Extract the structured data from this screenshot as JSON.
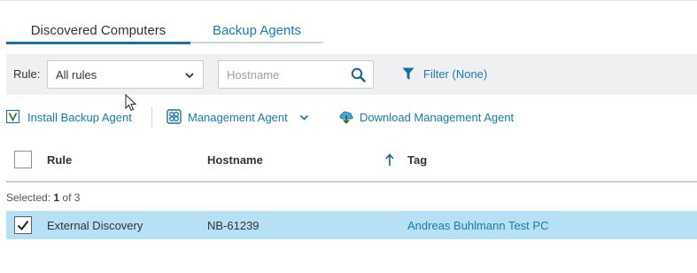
{
  "tabs": [
    {
      "label": "Discovered Computers",
      "active": true
    },
    {
      "label": "Backup Agents",
      "active": false
    }
  ],
  "filter": {
    "rule_label": "Rule:",
    "rule_value": "All rules",
    "hostname_placeholder": "Hostname",
    "filter_label": "Filter (None)"
  },
  "actions": {
    "install": "Install Backup Agent",
    "management": "Management Agent",
    "download": "Download Management Agent"
  },
  "columns": {
    "rule": "Rule",
    "hostname": "Hostname",
    "tag": "Tag"
  },
  "selection": {
    "prefix": "Selected: ",
    "count": "1",
    "suffix": " of 3"
  },
  "rows": [
    {
      "rule": "External Discovery",
      "hostname": "NB-61239",
      "tag": "Andreas Buhlmann Test PC",
      "selected": true
    }
  ],
  "colors": {
    "accent": "#1a7aa8",
    "tab_underline": "#1f6f9b",
    "selected_row": "#b8e0f5",
    "filter_bar": "#eef0f1"
  }
}
